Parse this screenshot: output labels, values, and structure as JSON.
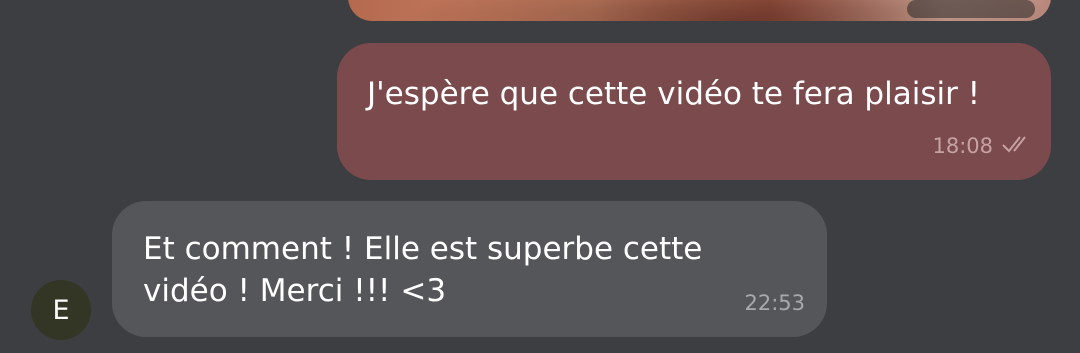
{
  "messages": {
    "outgoing": {
      "text": "J'espère que cette vidéo te fera plaisir !",
      "time": "18:08",
      "status_icon": "double-check-icon"
    },
    "incoming": {
      "text": "Et comment ! Elle est superbe cette vidéo ! Merci !!! <3",
      "time": "22:53",
      "avatar_initial": "E"
    }
  },
  "colors": {
    "background": "#3d3e42",
    "outgoing_bubble": "#7b4a4c",
    "incoming_bubble": "#55565a",
    "avatar": "#333624"
  }
}
